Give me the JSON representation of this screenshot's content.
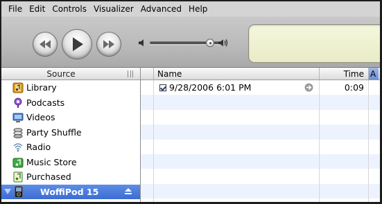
{
  "menu": [
    "File",
    "Edit",
    "Controls",
    "Visualizer",
    "Advanced",
    "Help"
  ],
  "controls": {
    "prev_icon": "rewind-icon",
    "play_icon": "play-icon",
    "next_icon": "fast-forward-icon",
    "volume_level": 0.85
  },
  "source": {
    "header": "Source",
    "items": [
      {
        "label": "Library",
        "icon": "library-icon"
      },
      {
        "label": "Podcasts",
        "icon": "podcast-icon"
      },
      {
        "label": "Videos",
        "icon": "video-icon"
      },
      {
        "label": "Party Shuffle",
        "icon": "party-shuffle-icon"
      },
      {
        "label": "Radio",
        "icon": "radio-icon"
      },
      {
        "label": "Music Store",
        "icon": "music-store-icon"
      },
      {
        "label": "Purchased",
        "icon": "purchased-icon"
      }
    ],
    "device": {
      "label": "WoffiPod 15",
      "icon": "ipod-icon"
    }
  },
  "table": {
    "columns": {
      "name": "Name",
      "time": "Time",
      "extra": "A"
    },
    "rows": [
      {
        "checked": true,
        "name": "9/28/2006 6:01 PM",
        "time": "0:09"
      }
    ]
  },
  "colors": {
    "selection": "#3c6cd2",
    "stripe": "#edf3fe",
    "lcd": "#f2f4d6"
  }
}
